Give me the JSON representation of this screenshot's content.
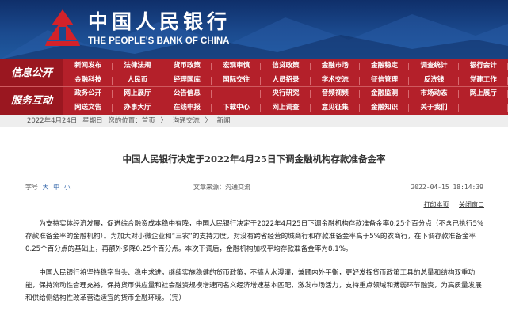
{
  "header": {
    "bank_name_cn": "中国人民银行",
    "bank_name_en": "THE PEOPLE'S BANK OF CHINA"
  },
  "nav": {
    "section_labels": [
      "信息公开",
      "服务互动"
    ],
    "rows": [
      [
        "新闻发布",
        "法律法规",
        "货币政策",
        "宏观审慎",
        "信贷政策",
        "金融市场",
        "金融稳定",
        "调查统计",
        "银行会计",
        "支付体系"
      ],
      [
        "金融科技",
        "人民币",
        "经理国库",
        "国际交往",
        "人员招录",
        "学术交流",
        "征信管理",
        "反洗钱",
        "党建工作",
        "工会工作"
      ],
      [
        "政务公开",
        "网上展厅",
        "公告信息",
        "",
        "央行研究",
        "音频视频",
        "金融监测",
        "市场动态",
        "网上展厅",
        "报告下载"
      ],
      [
        "网送文告",
        "办事大厅",
        "在线申报",
        "下载中心",
        "网上调查",
        "意见征集",
        "金融知识",
        "关于我们",
        "",
        ""
      ]
    ]
  },
  "breadcrumb": {
    "date": "2022年4月24日",
    "weekday": "星期日",
    "location_label": "您的位置：首页",
    "sep": "〉",
    "level2": "沟通交流",
    "level3": "新闻"
  },
  "article": {
    "title": "中国人民银行决定于2022年4月25日下调金融机构存款准备金率",
    "font_size_label": "字号",
    "font_sizes": [
      "大",
      "中",
      "小"
    ],
    "source": "文章来源：沟通交流",
    "datetime": "2022-04-15 18:14:39",
    "print_label": "打印本页",
    "close_label": "关闭窗口",
    "paragraphs": [
      "为支持实体经济发展，促进综合融资成本稳中有降，中国人民银行决定于2022年4月25日下调金融机构存款准备金率0.25个百分点（不含已执行5%存款准备金率的金融机构）。为加大对小微企业和“三农”的支持力度，对没有跨省经营的城商行和存款准备金率高于5%的农商行，在下调存款准备金率0.25个百分点的基础上，再额外多降0.25个百分点。本次下调后，金融机构加权平均存款准备金率为8.1%。",
      "中国人民银行将坚持稳字当头、稳中求进，继续实施稳健的货币政策，不搞大水漫灌，兼顾内外平衡，更好发挥货币政策工具的总量和结构双重功能，保持流动性合理充裕，保持货币供应量和社会融资规模增速同名义经济增速基本匹配，激发市场活力，支持重点领域和薄弱环节融资，为高质量发展和供给侧结构性改革营造适宜的货币金融环境。（完）"
    ]
  },
  "colors": {
    "header_blue": "#1b4a8e",
    "nav_red": "#b4202a"
  }
}
